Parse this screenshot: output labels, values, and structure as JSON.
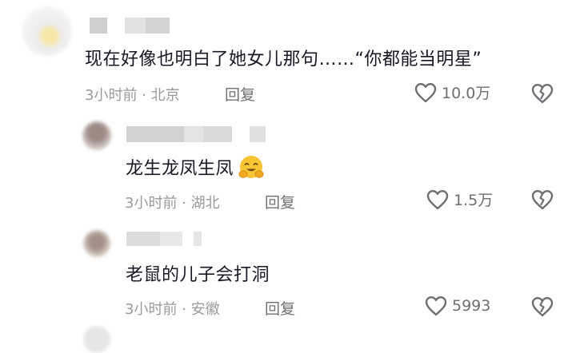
{
  "comments": [
    {
      "body": "现在好像也明白了她女儿那句……“你都能当明星”",
      "time_location": "3小时前 · 北京",
      "reply_label": "回复",
      "likes": "10.0万"
    }
  ],
  "replies": [
    {
      "body": "龙生龙凤生凤",
      "emoji": "hugging-face-emoji",
      "time_location": "3小时前 · 湖北",
      "reply_label": "回复",
      "likes": "1.5万"
    },
    {
      "body": "老鼠的儿子会打洞",
      "time_location": "3小时前 · 安徽",
      "reply_label": "回复",
      "likes": "5993"
    }
  ],
  "icons": {
    "like": "heart-outline-icon",
    "dislike": "broken-heart-icon"
  },
  "colors": {
    "text_primary": "#161823",
    "text_meta": "#9a9a9e",
    "icon_gray": "#6e6e73",
    "emoji_yellow": "#f7c433"
  }
}
